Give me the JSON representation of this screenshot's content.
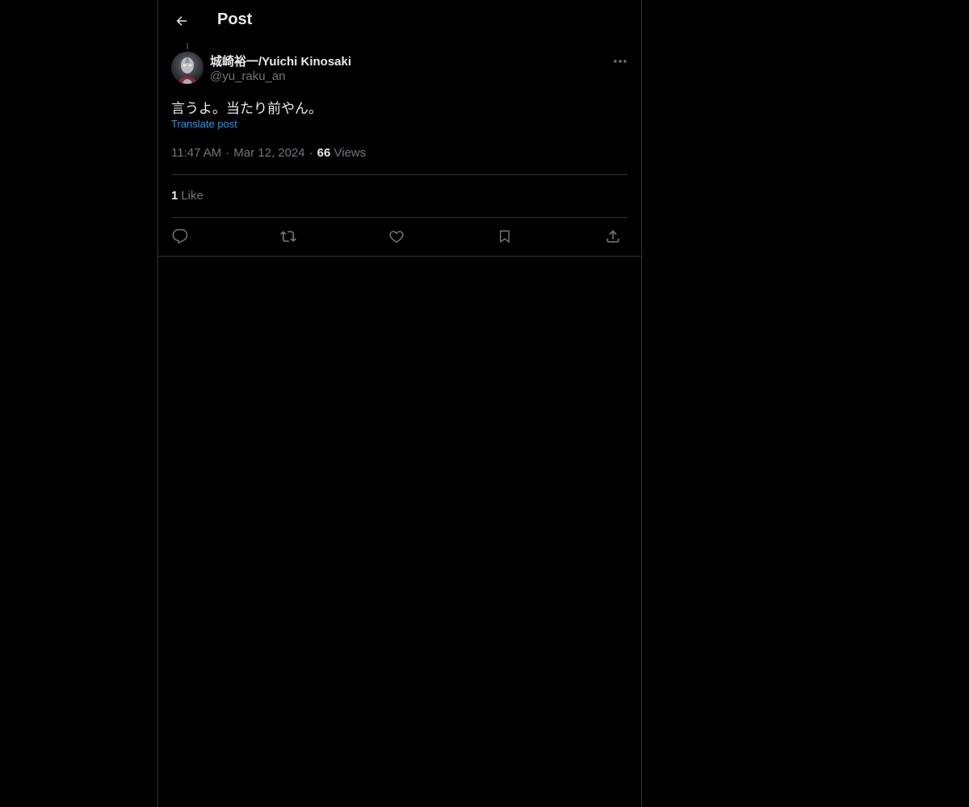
{
  "header": {
    "title": "Post",
    "back_icon": "arrow-left-icon"
  },
  "post": {
    "author": {
      "name": "城崎裕一/Yuichi Kinosaki",
      "handle": "@yu_raku_an"
    },
    "text": "言うよ。当たり前やん。",
    "translate_label": "Translate post",
    "time": "11:47 AM",
    "date": "Mar 12, 2024",
    "views_count": "66",
    "views_label": "Views",
    "likes_count": "1",
    "likes_label": "Like"
  },
  "actions": {
    "icons": [
      "reply-icon",
      "repost-icon",
      "like-icon",
      "bookmark-icon",
      "share-icon"
    ]
  },
  "colors": {
    "background": "#000000",
    "text": "#e7e9ea",
    "muted": "#71767b",
    "link": "#1d9bf0",
    "border": "#2f3336"
  }
}
